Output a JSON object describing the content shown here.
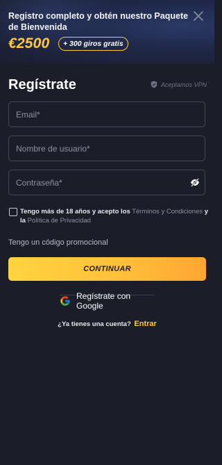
{
  "banner": {
    "text": "Registro completo y obtén nuestro Paquete de Bienvenida",
    "bonus_amount": "€2500",
    "spins_label": "+ 300 giros gratis"
  },
  "form": {
    "title": "Regístrate",
    "vpn_label": "Aceptamos VPN",
    "email_placeholder": "Email*",
    "username_placeholder": "Nombre de usuario*",
    "password_placeholder": "Contraseña*",
    "terms_prefix": "Tengo más de 18 años y acepto los",
    "terms_link": "Términos y Condiciones",
    "terms_and": "y la",
    "privacy_link": "Política de Privacidad",
    "promo_label": "Tengo un código promocional",
    "continue_label": "CONTINUAR",
    "google_label": "Regístrate con Google",
    "login_question": "¿Ya tienes una cuenta?",
    "login_link": "Entrar"
  },
  "colors": {
    "background": "#1b1e29",
    "accent": "#ffc93c",
    "field_border": "#434757"
  },
  "icons": [
    "close-icon",
    "shield-icon",
    "eye-off-icon",
    "google-icon"
  ]
}
